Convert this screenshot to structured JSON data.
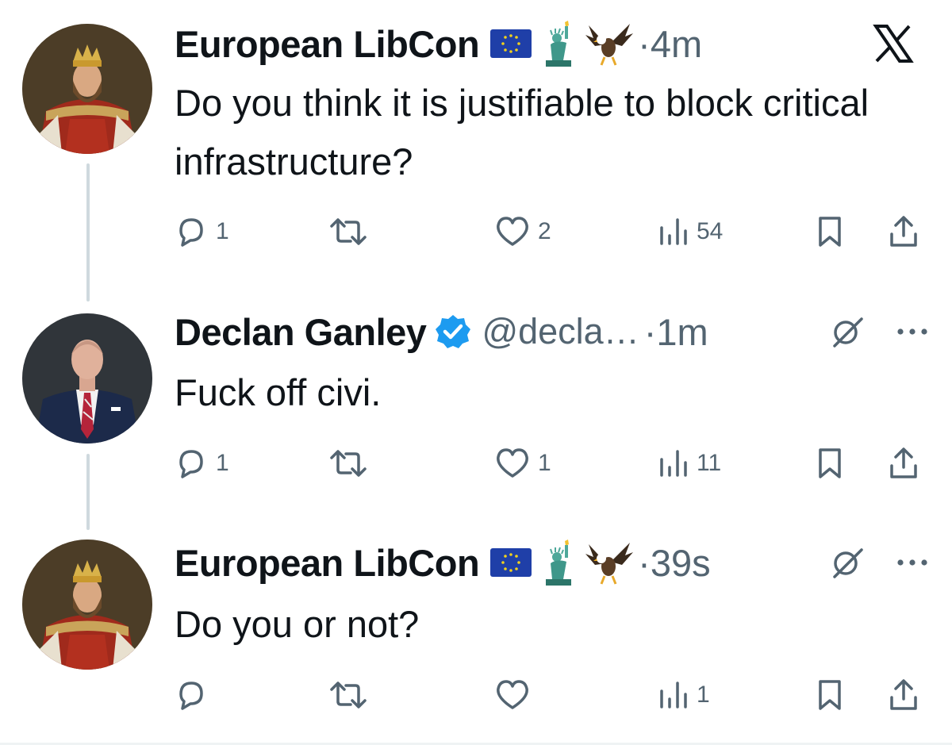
{
  "tweets": [
    {
      "name": "European LibCon",
      "time": "4m",
      "text": "Do you think it is justifiable to block critical infrastructure?",
      "counts": {
        "replies": "1",
        "reposts": "",
        "likes": "2",
        "views": "54"
      },
      "header_right_icon": "x-logo-icon"
    },
    {
      "name": "Declan Ganley",
      "verified": true,
      "handle": "@decla…",
      "time": "1m",
      "text": "Fuck off civi.",
      "counts": {
        "replies": "1",
        "reposts": "",
        "likes": "1",
        "views": "11"
      },
      "header_right_icon": "grok-icon"
    },
    {
      "name": "European LibCon",
      "time": "39s",
      "text": "Do you or not?",
      "counts": {
        "replies": "",
        "reposts": "",
        "likes": "",
        "views": "1"
      },
      "header_right_icon": "grok-icon"
    }
  ],
  "separator": "·",
  "colors": {
    "text": "#0f1419",
    "secondary": "#536471",
    "verified": "#1d9bf0",
    "thread_line": "#cfd9de"
  }
}
